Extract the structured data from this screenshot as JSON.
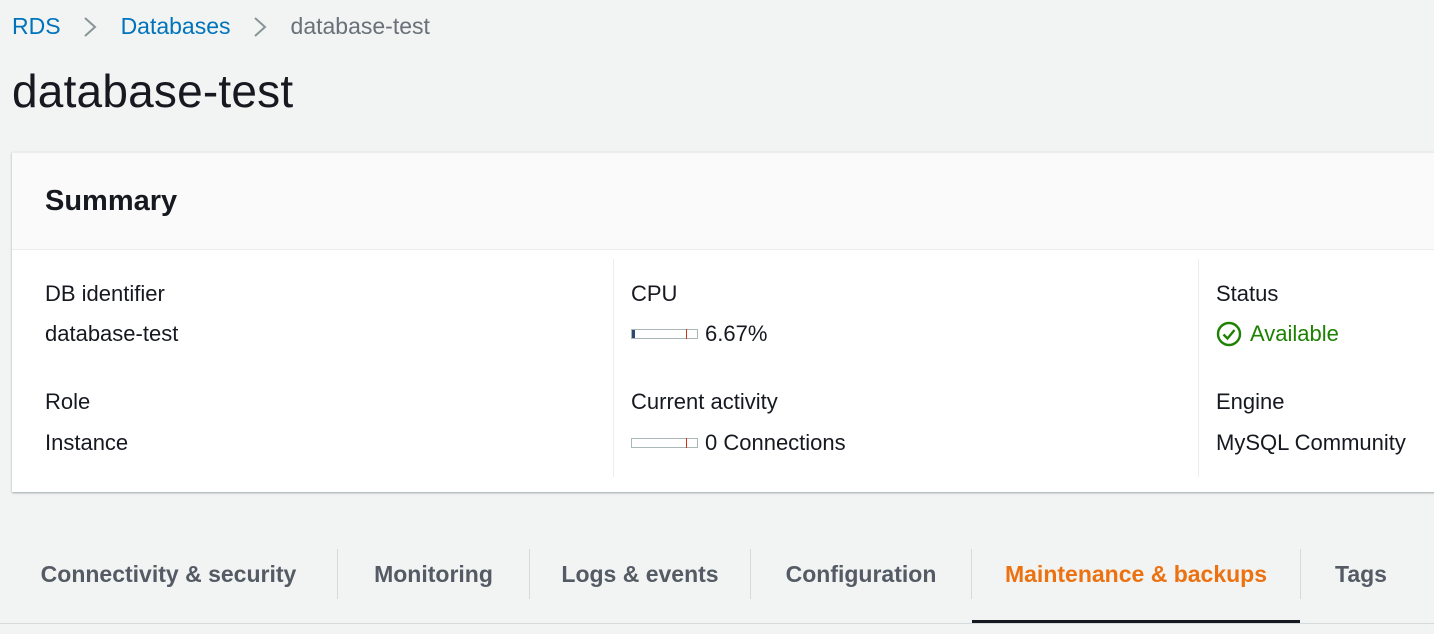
{
  "breadcrumb": {
    "rds": "RDS",
    "databases": "Databases",
    "current": "database-test"
  },
  "page_title": "database-test",
  "summary": {
    "title": "Summary",
    "db_identifier_label": "DB identifier",
    "db_identifier_value": "database-test",
    "role_label": "Role",
    "role_value": "Instance",
    "cpu_label": "CPU",
    "cpu_value": "6.67%",
    "cpu_fraction": 0.0667,
    "activity_label": "Current activity",
    "activity_value": "0 Connections",
    "activity_fraction": 0,
    "status_label": "Status",
    "status_value": "Available",
    "engine_label": "Engine",
    "engine_value": "MySQL Community"
  },
  "tabs": [
    {
      "label": "Connectivity & security",
      "active": false
    },
    {
      "label": "Monitoring",
      "active": false
    },
    {
      "label": "Logs & events",
      "active": false
    },
    {
      "label": "Configuration",
      "active": false
    },
    {
      "label": "Maintenance & backups",
      "active": true
    },
    {
      "label": "Tags",
      "active": false
    }
  ],
  "icons": {
    "breadcrumb_separator": "chevron-right-icon",
    "status": "check-circle-icon"
  },
  "colors": {
    "link": "#0073bb",
    "active_tab": "#ec7211",
    "status_ok": "#1d8102",
    "meter_fill": "#2b4a6f",
    "meter_threshold": "#d13212"
  }
}
